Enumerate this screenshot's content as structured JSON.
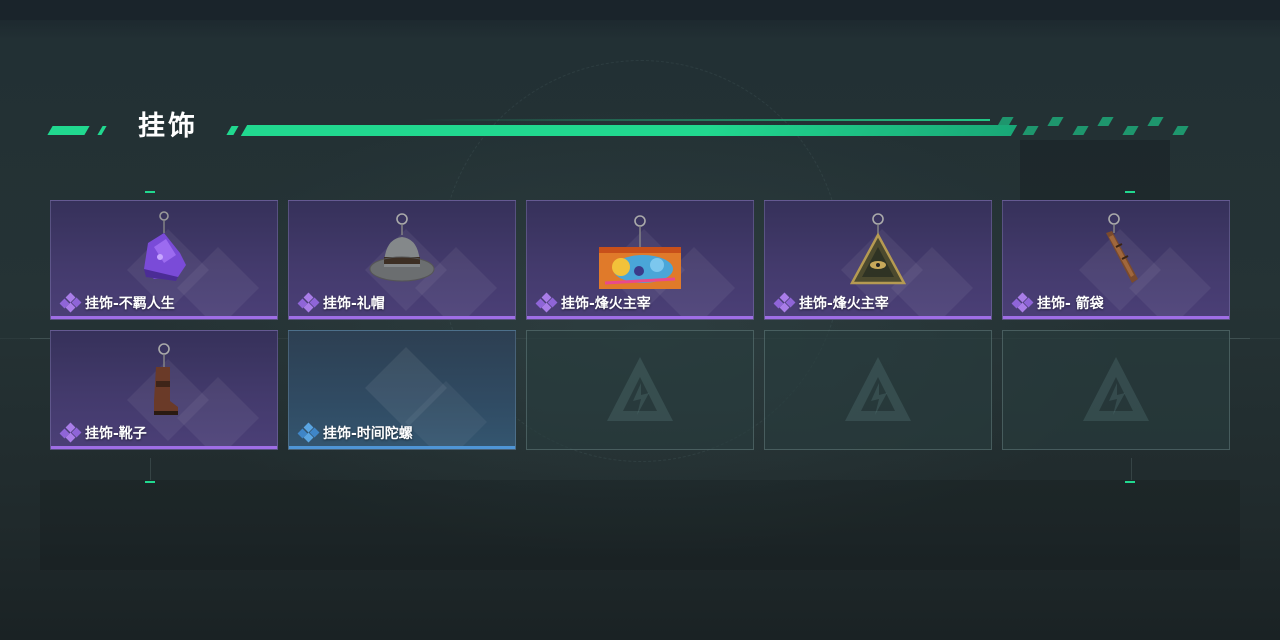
{
  "section": {
    "title": "挂饰"
  },
  "items": [
    {
      "label": "挂饰-不羁人生",
      "rarity": "purple",
      "icon": "sneaker-charm-icon"
    },
    {
      "label": "挂饰-礼帽",
      "rarity": "purple",
      "icon": "hat-charm-icon"
    },
    {
      "label": "挂饰-烽火主宰",
      "rarity": "purple",
      "icon": "graffiti-card-charm-icon"
    },
    {
      "label": "挂饰-烽火主宰",
      "rarity": "purple",
      "icon": "pyramid-charm-icon"
    },
    {
      "label": "挂饰- 箭袋",
      "rarity": "purple",
      "icon": "quiver-charm-icon"
    },
    {
      "label": "挂饰-靴子",
      "rarity": "purple",
      "icon": "boot-charm-icon"
    },
    {
      "label": "挂饰-时间陀螺",
      "rarity": "blue",
      "icon": ""
    }
  ],
  "empty_slots": 3,
  "colors": {
    "accent": "#21d88f",
    "purple_rarity": "#9f6ee6",
    "blue_rarity": "#4f95d6"
  }
}
